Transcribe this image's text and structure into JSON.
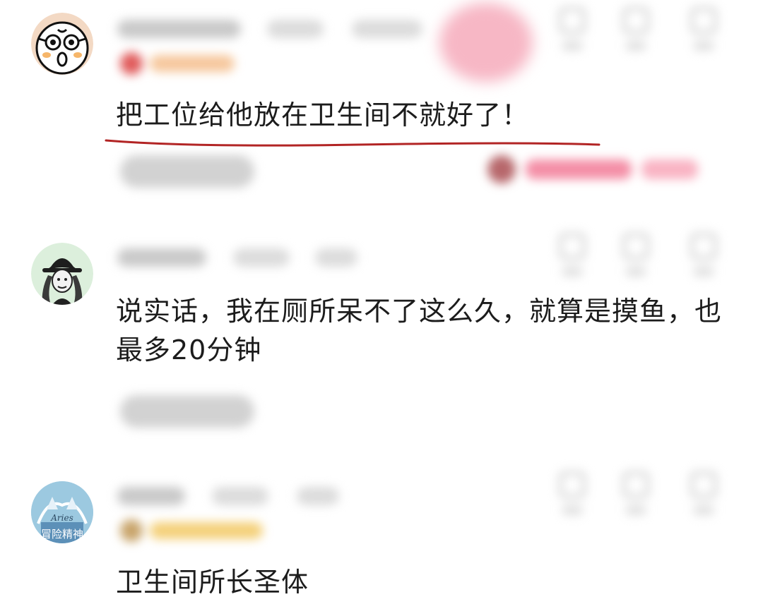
{
  "comments": [
    {
      "text": "把工位给他放在卫生间不就好了！",
      "avatar_icon": "surprised-face-avatar-icon"
    },
    {
      "text": "说实话，我在厕所呆不了这么久，就算是摸鱼，也最多20分钟",
      "avatar_icon": "hat-person-avatar-icon"
    },
    {
      "text": "卫生间所长圣体",
      "avatar_icon": "aries-avatar-icon",
      "avatar_text_top": "Aries",
      "avatar_text_bottom": "冒险精神"
    }
  ],
  "colors": {
    "underline": "#b22424",
    "highlight_pink": "#f48ea6",
    "badge_orange": "#f6b980",
    "badge_red": "#e05a5a"
  }
}
